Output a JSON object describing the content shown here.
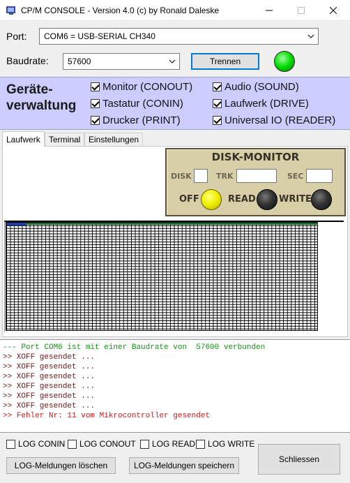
{
  "window": {
    "title": "CP/M CONSOLE - Version 4.0 (c) by Ronald Daleske",
    "icon": "app-icon",
    "controls": {
      "minimize": "–",
      "maximize": "☐",
      "close": "✕"
    }
  },
  "connection": {
    "port_label": "Port:",
    "port_value": "COM6 = USB-SERIAL CH340",
    "baud_label": "Baudrate:",
    "baud_value": "57600",
    "disconnect_button": "Trennen",
    "status_color": "#00dd00"
  },
  "devices": {
    "title": "Geräte-\nverwaltung",
    "left": [
      {
        "label": "Monitor (CONOUT)",
        "checked": true
      },
      {
        "label": "Tastatur (CONIN)",
        "checked": true
      },
      {
        "label": "Drucker (PRINT)",
        "checked": true
      }
    ],
    "right": [
      {
        "label": "Audio (SOUND)",
        "checked": true
      },
      {
        "label": "Laufwerk (DRIVE)",
        "checked": true
      },
      {
        "label": "Universal IO (READER)",
        "checked": true
      }
    ]
  },
  "tabs": [
    "Laufwerk",
    "Terminal",
    "Einstellungen"
  ],
  "active_tab": "Laufwerk",
  "disk_monitor": {
    "title": "DISK-MONITOR",
    "disk_label": "DISK",
    "trk_label": "TRK",
    "sec_label": "SEC",
    "disk_value": "",
    "trk_value": "",
    "sec_value": "",
    "off_label": "OFF",
    "read_label": "READ",
    "write_label": "WRITE",
    "off_led_color": "#f2f200",
    "read_led_color": "#222222",
    "write_led_color": "#222222"
  },
  "log": [
    {
      "text": "--- Port COM6 ist mit einer Baudrate von  57600 verbunden",
      "color": "#1a8c1a"
    },
    {
      "text": ">> XOFF gesendet ...",
      "color": "#6b1a1a"
    },
    {
      "text": ">> XOFF gesendet ...",
      "color": "#6b1a1a"
    },
    {
      "text": ">> XOFF gesendet ...",
      "color": "#6b1a1a"
    },
    {
      "text": ">> XOFF gesendet ...",
      "color": "#6b1a1a"
    },
    {
      "text": ">> XOFF gesendet ...",
      "color": "#6b1a1a"
    },
    {
      "text": ">> XOFF gesendet ...",
      "color": "#6b1a1a"
    },
    {
      "text": ">> Fehler Nr: 11 vom Mikrocontroller gesendet",
      "color": "#cc1a1a"
    }
  ],
  "log_options": [
    {
      "label": "LOG CONIN",
      "checked": false
    },
    {
      "label": "LOG CONOUT",
      "checked": false
    },
    {
      "label": "LOG READ",
      "checked": false
    },
    {
      "label": "LOG WRITE",
      "checked": false
    }
  ],
  "buttons": {
    "clear_log": "LOG-Meldungen löschen",
    "save_log": "LOG-Meldungen speichern",
    "close": "Schliessen"
  }
}
